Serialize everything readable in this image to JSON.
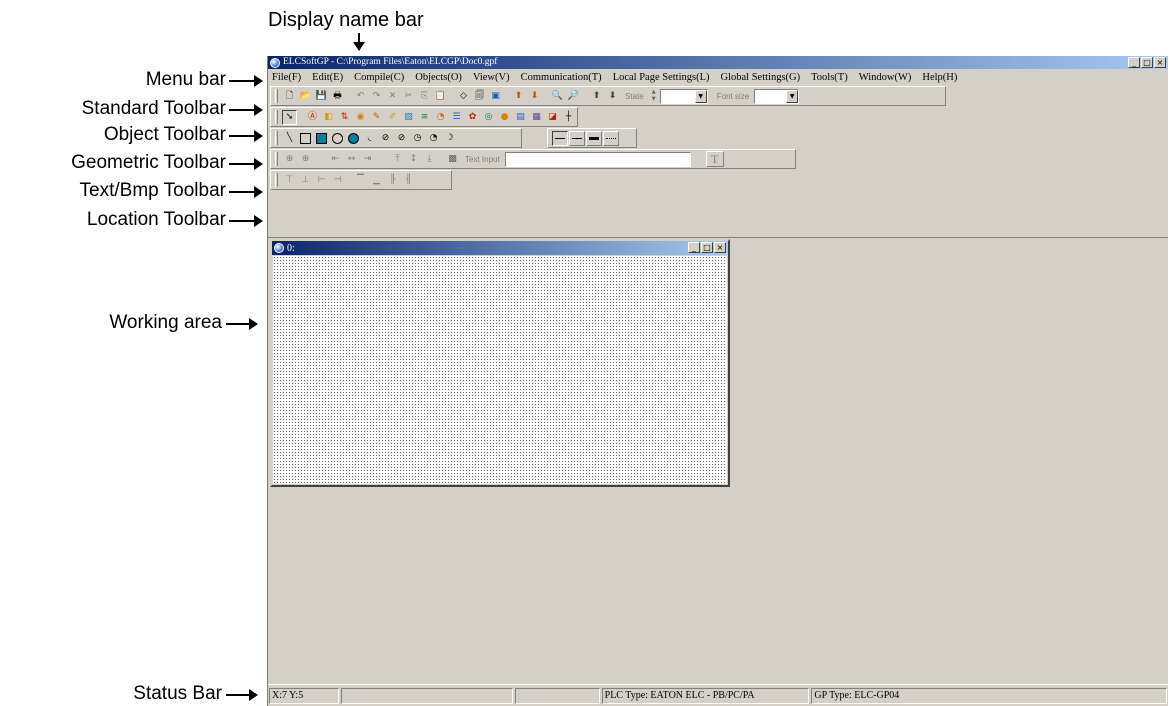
{
  "annotations": {
    "display_name_bar": "Display name bar",
    "menu_bar": "Menu bar",
    "standard_toolbar": "Standard Toolbar",
    "object_toolbar": "Object Toolbar",
    "geometric_toolbar": "Geometric Toolbar",
    "text_bmp_toolbar": "Text/Bmp Toolbar",
    "location_toolbar": "Location Toolbar",
    "working_area": "Working area",
    "status_bar": "Status Bar"
  },
  "window": {
    "title": "ELCSoftGP - C:\\Program Files\\Eaton\\ELCGP\\Doc0.gpf",
    "controls": [
      "_",
      "□",
      "×"
    ]
  },
  "menu": {
    "items": [
      {
        "label": "File(F)"
      },
      {
        "label": "Edit(E)"
      },
      {
        "label": "Compile(C)"
      },
      {
        "label": "Objects(O)"
      },
      {
        "label": "View(V)"
      },
      {
        "label": "Communication(T)"
      },
      {
        "label": "Local Page Settings(L)"
      },
      {
        "label": "Global Settings(G)"
      },
      {
        "label": "Tools(T)"
      },
      {
        "label": "Window(W)"
      },
      {
        "label": "Help(H)"
      }
    ]
  },
  "toolbars": {
    "standard": {
      "state_label": "State",
      "font_size_label": "Font size",
      "state_value": "",
      "font_size_value": ""
    },
    "text_bmp": {
      "text_input_label": "Text Input",
      "text_input_value": "",
      "text_button": "T"
    }
  },
  "child_window": {
    "title": "0:"
  },
  "status": {
    "coords": "X:7 Y:5",
    "field2": "",
    "field3": "",
    "plc_type": "PLC Type: EATON ELC - PB/PC/PA",
    "gp_type": "GP Type: ELC-GP04"
  },
  "colors": {
    "title_gradient_start": "#0a246a",
    "title_gradient_end": "#a6caf0",
    "chrome": "#d4d0c8",
    "accent_fill": "#0080a0"
  }
}
